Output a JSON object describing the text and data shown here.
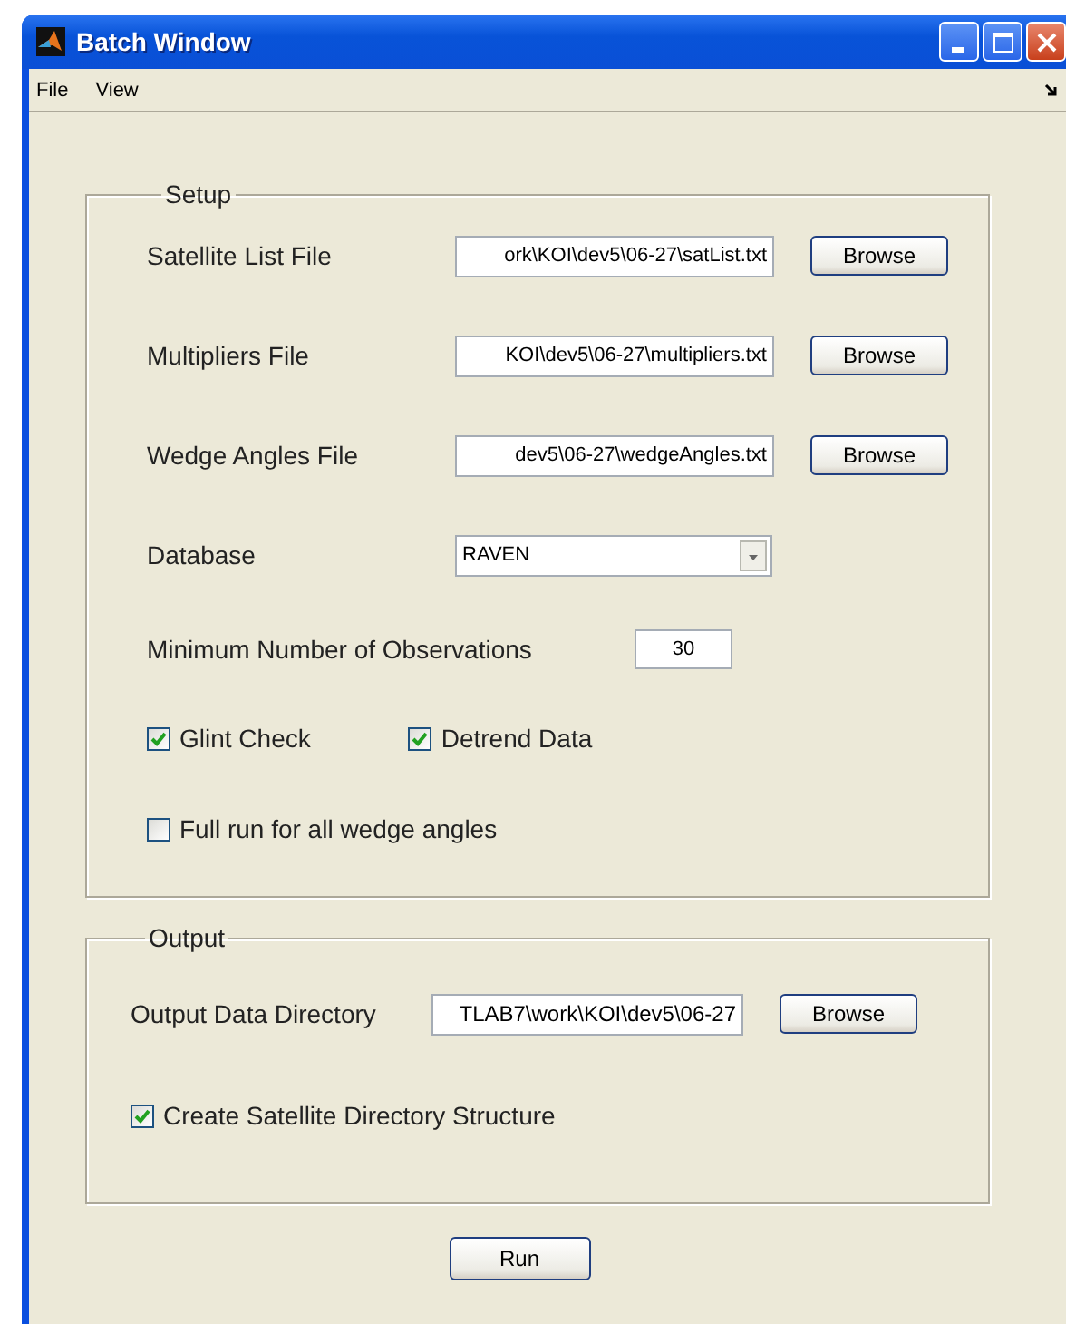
{
  "window": {
    "title": "Batch Window"
  },
  "menu": [
    {
      "label": "File"
    },
    {
      "label": "View"
    }
  ],
  "setup": {
    "title": "Setup",
    "file_rows": [
      {
        "label": "Satellite List File",
        "value": "ork\\KOI\\dev5\\06-27\\satList.txt",
        "button": "Browse"
      },
      {
        "label": "Multipliers File",
        "value": "KOI\\dev5\\06-27\\multipliers.txt",
        "button": "Browse"
      },
      {
        "label": "Wedge Angles File",
        "value": "dev5\\06-27\\wedgeAngles.txt",
        "button": "Browse"
      }
    ],
    "database": {
      "label": "Database",
      "value": "RAVEN"
    },
    "min_observations": {
      "label": "Minimum Number of Observations",
      "value": "30"
    },
    "checkbox_rows": [
      [
        {
          "label": "Glint Check",
          "checked": true
        },
        {
          "label": "Detrend Data",
          "checked": true
        }
      ],
      [
        {
          "label": "Full run for all wedge angles",
          "checked": false
        }
      ]
    ]
  },
  "output": {
    "title": "Output",
    "directory": {
      "label": "Output Data Directory",
      "value": "TLAB7\\work\\KOI\\dev5\\06-27",
      "button": "Browse"
    },
    "checkboxes": [
      {
        "label": "Create Satellite Directory Structure",
        "checked": true
      }
    ]
  },
  "run_button": "Run"
}
